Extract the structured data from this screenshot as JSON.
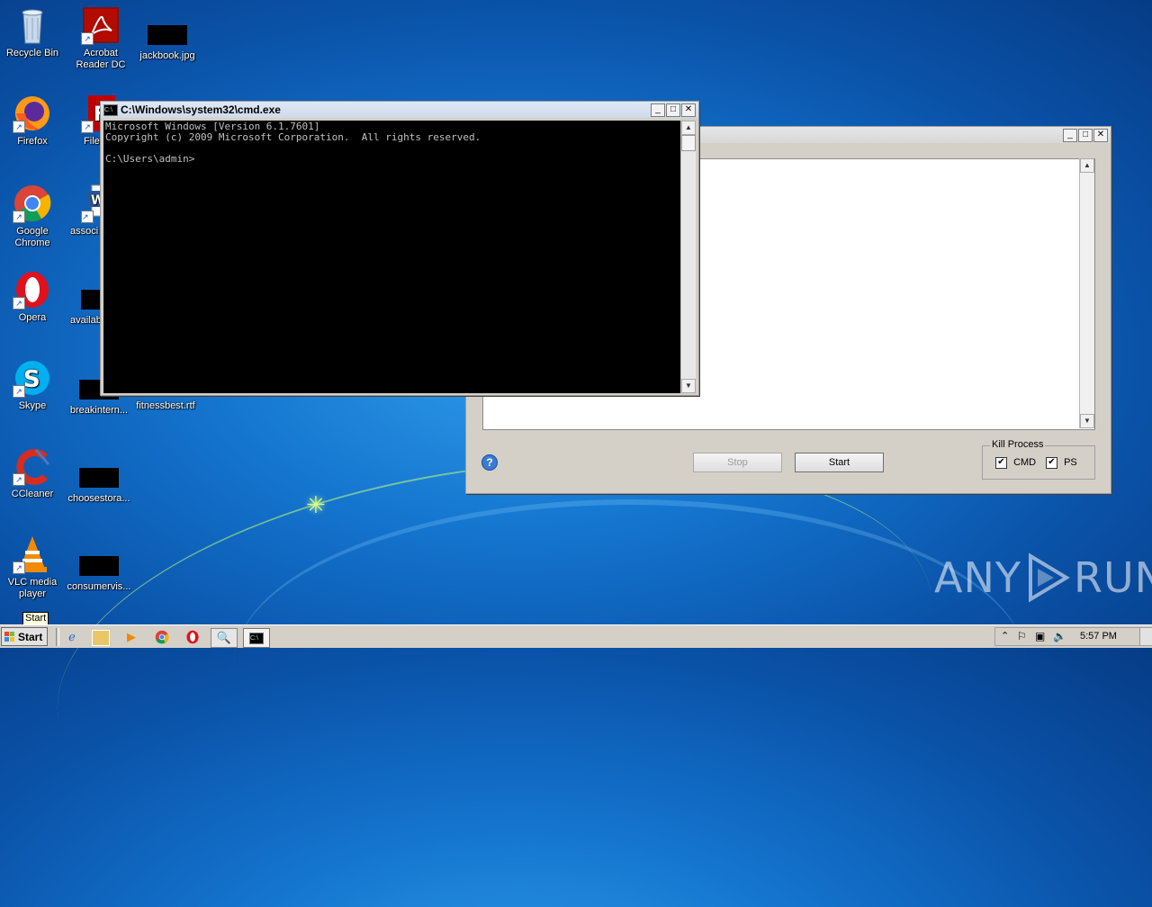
{
  "desktop": {
    "icons": [
      {
        "label": "Recycle Bin",
        "icon": "recycle-bin-icon"
      },
      {
        "label": "Acrobat Reader DC",
        "icon": "acrobat-icon"
      },
      {
        "label": "jackbook.jpg",
        "icon": "image-file-icon"
      },
      {
        "label": "Firefox",
        "icon": "firefox-icon"
      },
      {
        "label": "FileZilla",
        "icon": "filezilla-icon"
      },
      {
        "label": "Google Chrome",
        "icon": "chrome-icon"
      },
      {
        "label": "associ",
        "icon": "word-doc-icon"
      },
      {
        "label": "Opera",
        "icon": "opera-icon"
      },
      {
        "label": "availab",
        "icon": "file-icon"
      },
      {
        "label": "Skype",
        "icon": "skype-icon"
      },
      {
        "label": "breakintern...",
        "icon": "file-icon"
      },
      {
        "label": "fitnessbest.rtf",
        "icon": "rtf-file-icon"
      },
      {
        "label": "CCleaner",
        "icon": "ccleaner-icon"
      },
      {
        "label": "choosestora...",
        "icon": "file-icon"
      },
      {
        "label": "VLC media player",
        "icon": "vlc-icon"
      },
      {
        "label": "consumervis...",
        "icon": "file-icon"
      }
    ],
    "watermark": {
      "left": "ANY",
      "right": "RUN"
    }
  },
  "cmd_window": {
    "title": "C:\\Windows\\system32\\cmd.exe",
    "lines": [
      "Microsoft Windows [Version 6.1.7601]",
      "Copyright (c) 2009 Microsoft Corporation.  All rights reserved.",
      "",
      "C:\\Users\\admin>"
    ]
  },
  "app_window": {
    "title": "",
    "stop_label": "Stop",
    "start_label": "Start",
    "kill_process": {
      "legend": "Kill Process",
      "cmd_label": "CMD",
      "cmd_checked": true,
      "ps_label": "PS",
      "ps_checked": true
    }
  },
  "taskbar": {
    "start_label": "Start",
    "tooltip": "Start",
    "clock": "5:57 PM"
  }
}
